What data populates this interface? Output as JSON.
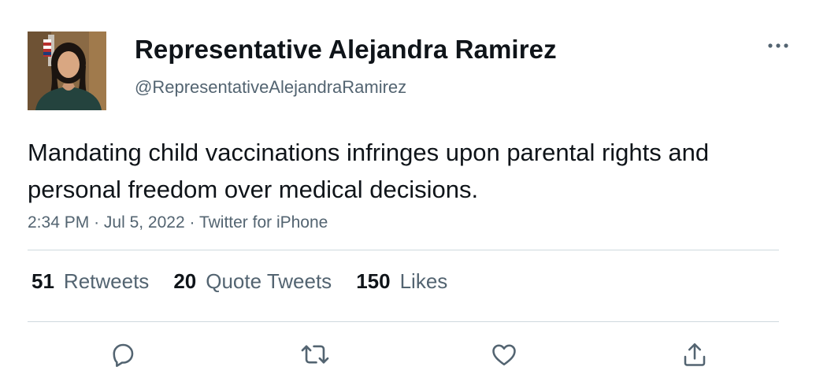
{
  "author": {
    "display_name": "Representative Alejandra Ramirez",
    "handle": "@RepresentativeAlejandraRamirez",
    "avatar_icon": "profile-photo"
  },
  "tweet": {
    "text": "Mandating child vaccinations infringes upon parental rights and personal freedom over medical decisions.",
    "time": "2:34 PM",
    "date": "Jul 5, 2022",
    "source": "Twitter for iPhone",
    "separator": "·"
  },
  "stats": {
    "retweets": {
      "count": "51",
      "label": "Retweets"
    },
    "quotes": {
      "count": "20",
      "label": "Quote Tweets"
    },
    "likes": {
      "count": "150",
      "label": "Likes"
    }
  },
  "actions": [
    "reply-icon",
    "retweet-icon",
    "like-icon",
    "share-icon"
  ],
  "colors": {
    "text": "#0f1419",
    "secondary": "#536471",
    "divider": "#cfd9de"
  }
}
